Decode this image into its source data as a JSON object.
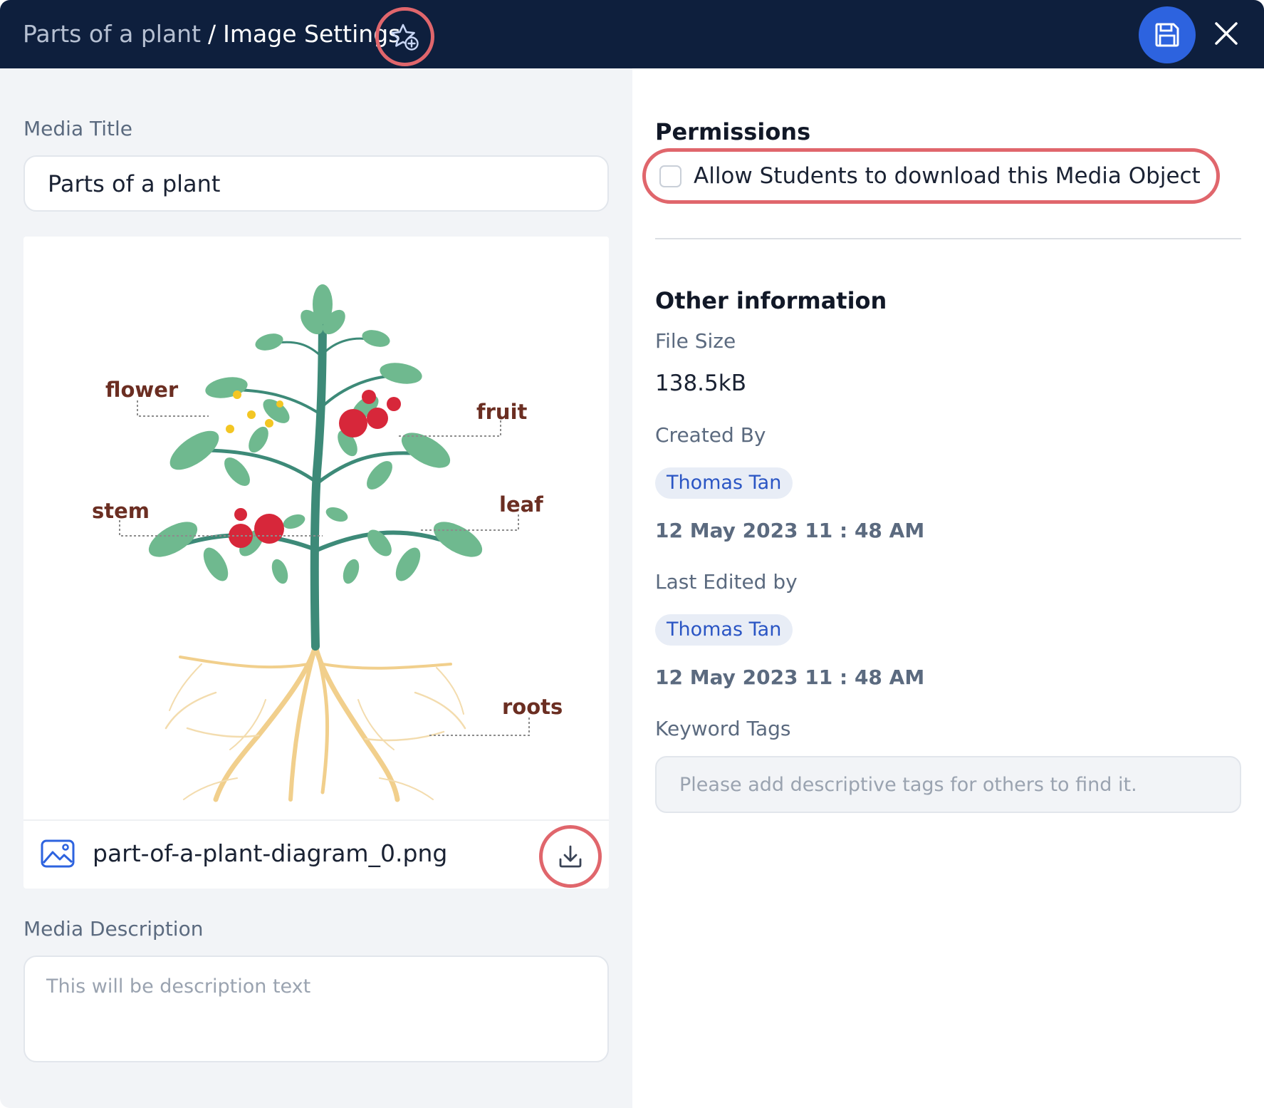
{
  "header": {
    "breadcrumb_parent": "Parts of a plant",
    "breadcrumb_separator": "/",
    "breadcrumb_current": "Image Settings"
  },
  "left": {
    "title_label": "Media Title",
    "title_value": "Parts of a plant",
    "file_name": "part-of-a-plant-diagram_0.png",
    "description_label": "Media Description",
    "description_placeholder": "This will be description text",
    "image_labels": {
      "flower": "flower",
      "fruit": "fruit",
      "stem": "stem",
      "leaf": "leaf",
      "roots": "roots"
    }
  },
  "right": {
    "permissions_heading": "Permissions",
    "permission_label": "Allow Students to download this Media Object",
    "permission_checked": false,
    "other_heading": "Other information",
    "file_size_label": "File Size",
    "file_size_value": "138.5kB",
    "created_by_label": "Created By",
    "created_by_user": "Thomas Tan",
    "created_date": "12 May 2023 11 : 48 AM",
    "edited_by_label": "Last Edited by",
    "edited_by_user": "Thomas Tan",
    "edited_date": "12 May 2023 11 : 48 AM",
    "keyword_label": "Keyword Tags",
    "keyword_placeholder": "Please add descriptive tags for others to find it."
  },
  "icons": {
    "favorite": "star-plus-icon",
    "save": "floppy-disk-icon",
    "close": "close-icon",
    "file": "image-file-icon",
    "download": "download-icon"
  },
  "colors": {
    "header_bg": "#0e1f3d",
    "accent_blue": "#2d63df",
    "highlight_red": "#e0666c",
    "chip_bg": "#e8edf6",
    "chip_text": "#2a55c4"
  }
}
